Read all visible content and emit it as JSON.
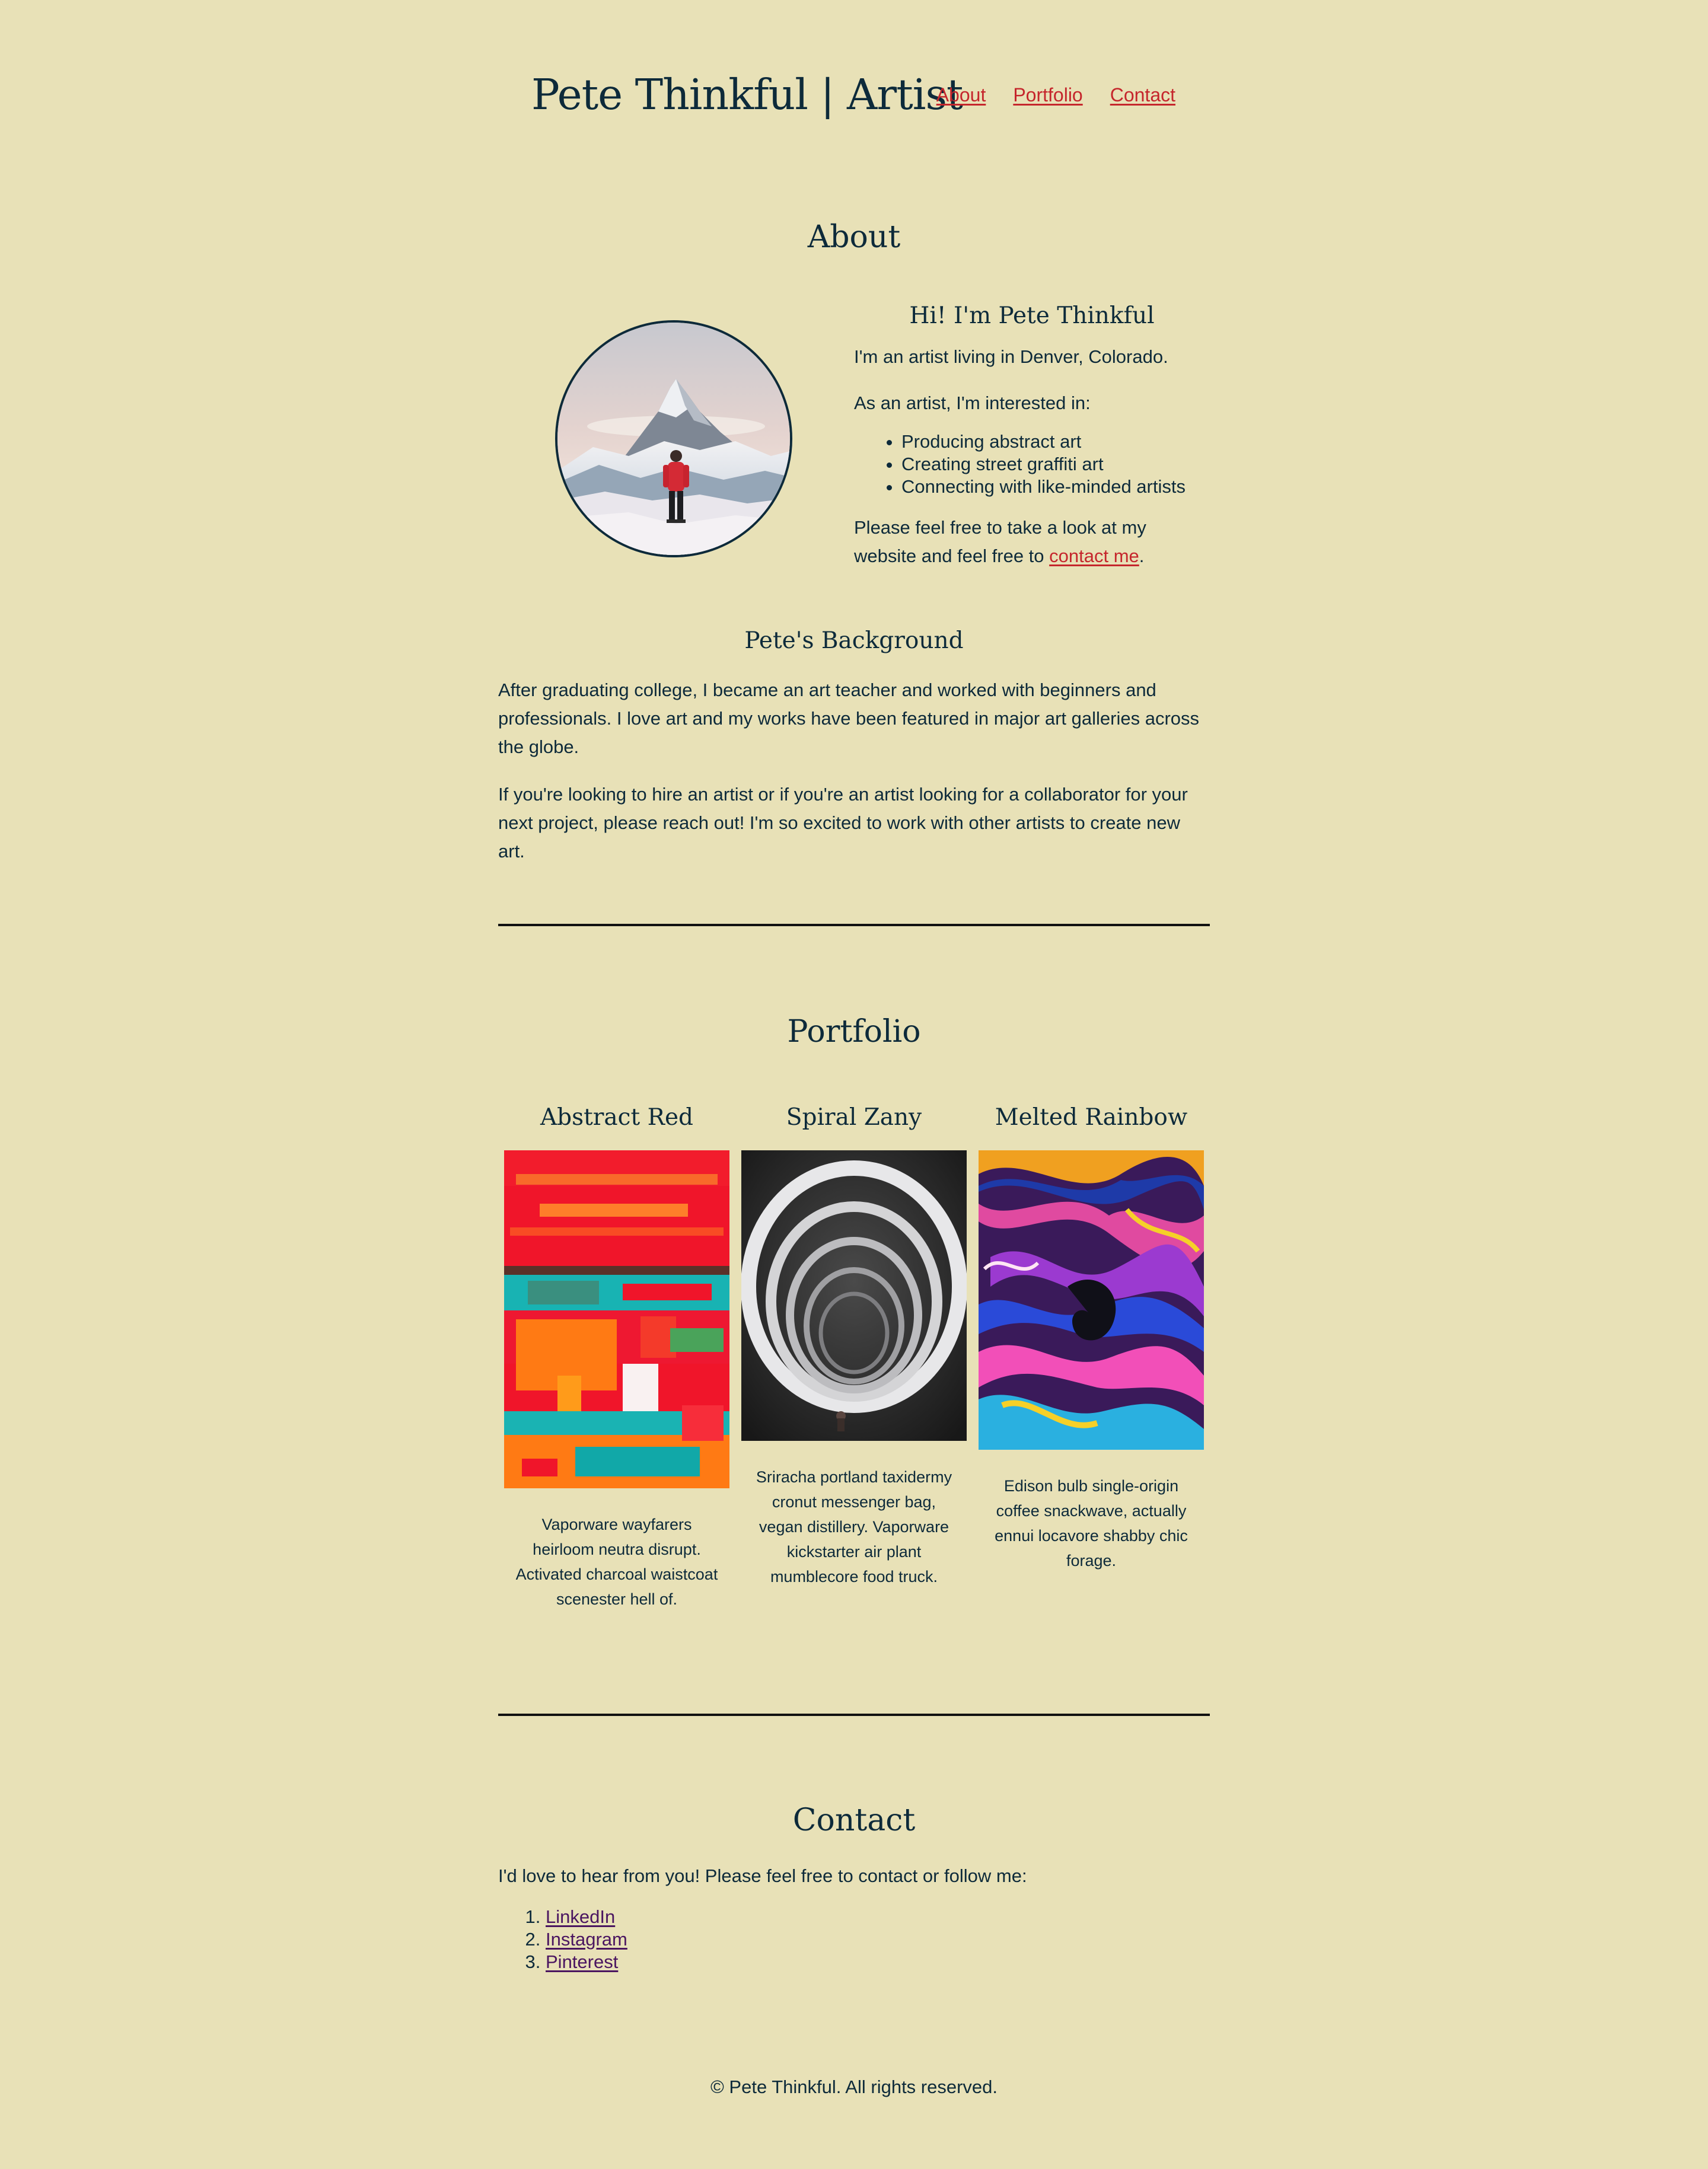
{
  "header": {
    "title": "Pete Thinkful | Artist",
    "nav": [
      "About",
      "Portfolio",
      "Contact"
    ]
  },
  "about": {
    "heading": "About",
    "greeting": "Hi! I'm Pete Thinkful",
    "intro": "I'm an artist living in Denver, Colorado.",
    "interests_lead": "As an artist, I'm interested in:",
    "interests": [
      "Producing abstract art",
      "Creating street graffiti art",
      "Connecting with like-minded artists"
    ],
    "cta_before": "Please feel free to take a look at my website and feel free to ",
    "cta_link": "contact me",
    "cta_after": ".",
    "background_heading": "Pete's Background",
    "background_p1": "After graduating college, I became an art teacher and worked with beginners and professionals. I love art and my works have been featured in major art galleries across the globe.",
    "background_p2": "If you're looking to hire an artist or if you're an artist looking for a collaborator for your next project, please reach out! I'm so excited to work with other artists to create new art."
  },
  "portfolio": {
    "heading": "Portfolio",
    "items": [
      {
        "title": "Abstract Red",
        "desc": "Vaporware wayfarers heirloom neutra disrupt. Activated charcoal waistcoat scenester hell of."
      },
      {
        "title": "Spiral Zany",
        "desc": "Sriracha portland taxidermy cronut messenger bag, vegan distillery. Vaporware kickstarter air plant mumblecore food truck."
      },
      {
        "title": "Melted Rainbow",
        "desc": "Edison bulb single-origin coffee snackwave, actually ennui locavore shabby chic forage."
      }
    ]
  },
  "contact": {
    "heading": "Contact",
    "intro": "I'd love to hear from you! Please feel free to contact or follow me:",
    "links": [
      "LinkedIn",
      "Instagram",
      "Pinterest"
    ]
  },
  "footer": {
    "text": "© Pete Thinkful. All rights reserved."
  },
  "colors": {
    "background": "#e8e1b7",
    "text": "#0d2a3a",
    "link": "#c5262c",
    "visited_link": "#4a1560"
  }
}
